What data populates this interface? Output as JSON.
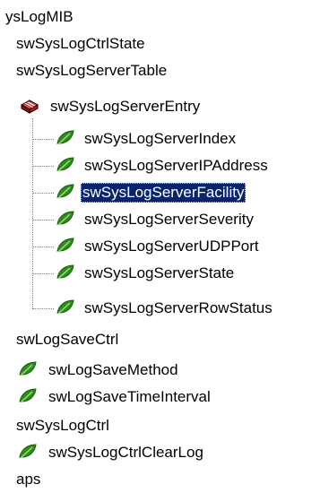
{
  "tree": {
    "items": [
      {
        "label": "ysLogMIB",
        "icon": "none",
        "depth": "root",
        "selected": false
      },
      {
        "label": "swSysLogCtrlState",
        "icon": "none",
        "depth": "root",
        "selected": false
      },
      {
        "label": "swSysLogServerTable",
        "icon": "none",
        "depth": "root",
        "selected": false
      },
      {
        "label": "swSysLogServerEntry",
        "icon": "table-entry-icon",
        "depth": "entry",
        "selected": false
      },
      {
        "label": "swSysLogServerIndex",
        "icon": "leaf-icon",
        "depth": "child",
        "selected": false
      },
      {
        "label": "swSysLogServerIPAddress",
        "icon": "leaf-icon",
        "depth": "child",
        "selected": false
      },
      {
        "label": "swSysLogServerFacility",
        "icon": "leaf-icon",
        "depth": "child",
        "selected": true
      },
      {
        "label": "swSysLogServerSeverity",
        "icon": "leaf-icon",
        "depth": "child",
        "selected": false
      },
      {
        "label": "swSysLogServerUDPPort",
        "icon": "leaf-icon",
        "depth": "child",
        "selected": false
      },
      {
        "label": "swSysLogServerState",
        "icon": "leaf-icon",
        "depth": "child",
        "selected": false
      },
      {
        "label": "swSysLogServerRowStatus",
        "icon": "leaf-icon",
        "depth": "child",
        "selected": false
      },
      {
        "label": "swLogSaveCtrl",
        "icon": "none",
        "depth": "root",
        "selected": false
      },
      {
        "label": "swLogSaveMethod",
        "icon": "leaf-icon",
        "depth": "entry",
        "selected": false
      },
      {
        "label": "swLogSaveTimeInterval",
        "icon": "leaf-icon",
        "depth": "entry",
        "selected": false
      },
      {
        "label": "swSysLogCtrl",
        "icon": "none",
        "depth": "root",
        "selected": false
      },
      {
        "label": "swSysLogCtrlClearLog",
        "icon": "leaf-icon",
        "depth": "entry",
        "selected": false
      },
      {
        "label": "aps",
        "icon": "none",
        "depth": "root",
        "selected": false
      }
    ],
    "colors": {
      "selection_bg": "#0a246a",
      "selection_text": "#ffffff",
      "leaf_green": "#2e8b1e",
      "entry_red": "#c81e1e"
    }
  }
}
